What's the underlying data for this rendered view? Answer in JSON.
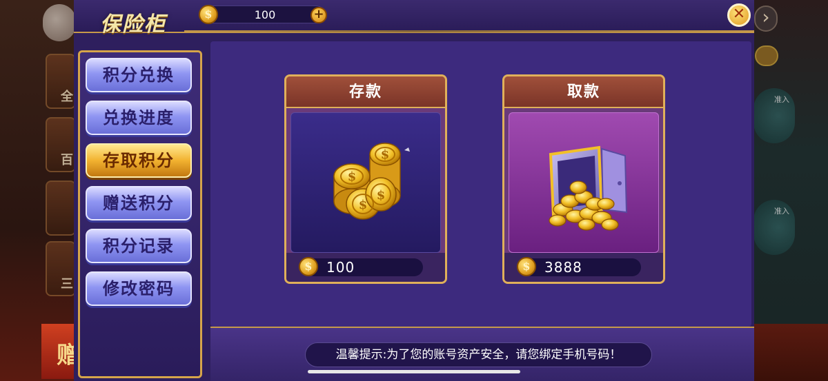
{
  "dialog": {
    "title": "保险柜",
    "balance": "100",
    "plus_symbol": "+",
    "close_symbol": "✕",
    "coin_symbol": "$"
  },
  "sidebar": {
    "items": [
      {
        "label": "积分兑换",
        "active": false
      },
      {
        "label": "兑换进度",
        "active": false
      },
      {
        "label": "存取积分",
        "active": true
      },
      {
        "label": "赠送积分",
        "active": false
      },
      {
        "label": "积分记录",
        "active": false
      },
      {
        "label": "修改密码",
        "active": false
      }
    ]
  },
  "cards": {
    "deposit": {
      "title": "存款",
      "amount": "100",
      "icon": "coin-stack-icon"
    },
    "withdraw": {
      "title": "取款",
      "amount": "3888",
      "icon": "safe-with-coins-icon"
    }
  },
  "tip": "温馨提示:为了您的账号资产安全，请您绑定手机号码！",
  "background": {
    "bottom_left_glyph": "赠",
    "right_arrow": "›",
    "table_label": "准入"
  },
  "colors": {
    "dialog_bg": "#2e1f5e",
    "gold_border": "#d6a54a",
    "active_button": "#f2b230",
    "inactive_button": "#8f95f2"
  }
}
